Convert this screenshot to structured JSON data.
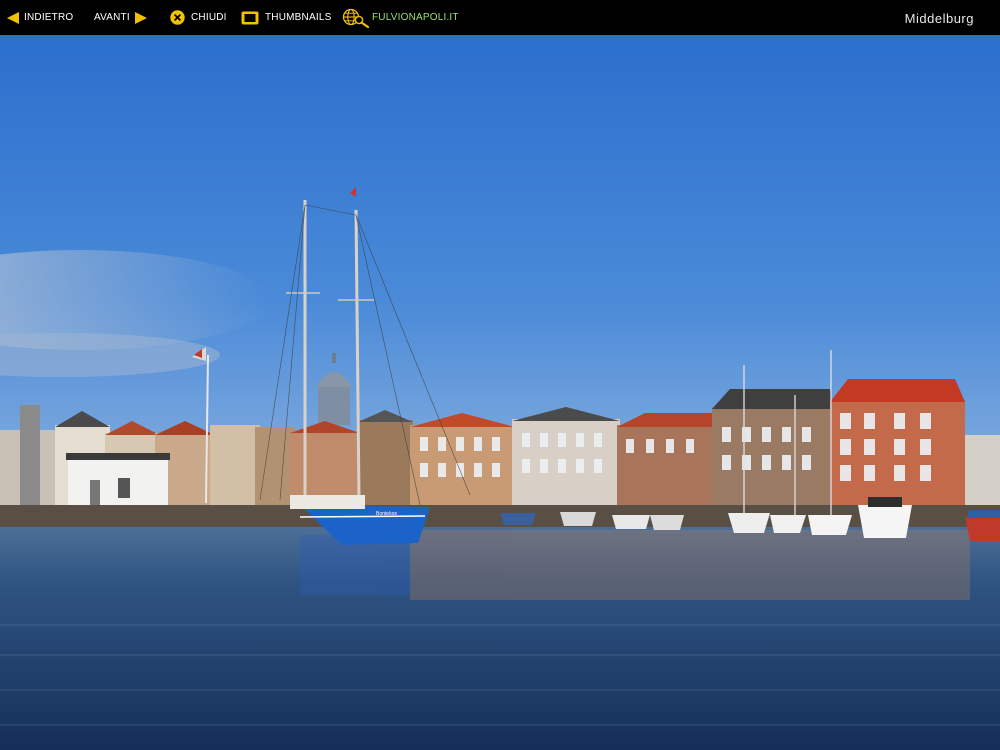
{
  "toolbar": {
    "back_label": "INDIETRO",
    "forward_label": "AVANTI",
    "close_label": "CHIUDI",
    "thumbnails_label": "THUMBNAILS",
    "site_label": "FULVIONAPOLI.IT"
  },
  "gallery": {
    "title": "Middelburg"
  },
  "photo": {
    "boat_name": "Bontekoe"
  },
  "colors": {
    "bar_bg": "#000000",
    "accent_yellow": "#f2c200",
    "site_link_green": "#9be36b",
    "sky_top": "#2a6fcf",
    "water": "#1d3f6e"
  },
  "icons": {
    "back": "arrow-left-icon",
    "forward": "arrow-right-icon",
    "close": "close-x-icon",
    "thumbnails": "thumbnail-square-icon",
    "site": "globe-search-icon"
  }
}
